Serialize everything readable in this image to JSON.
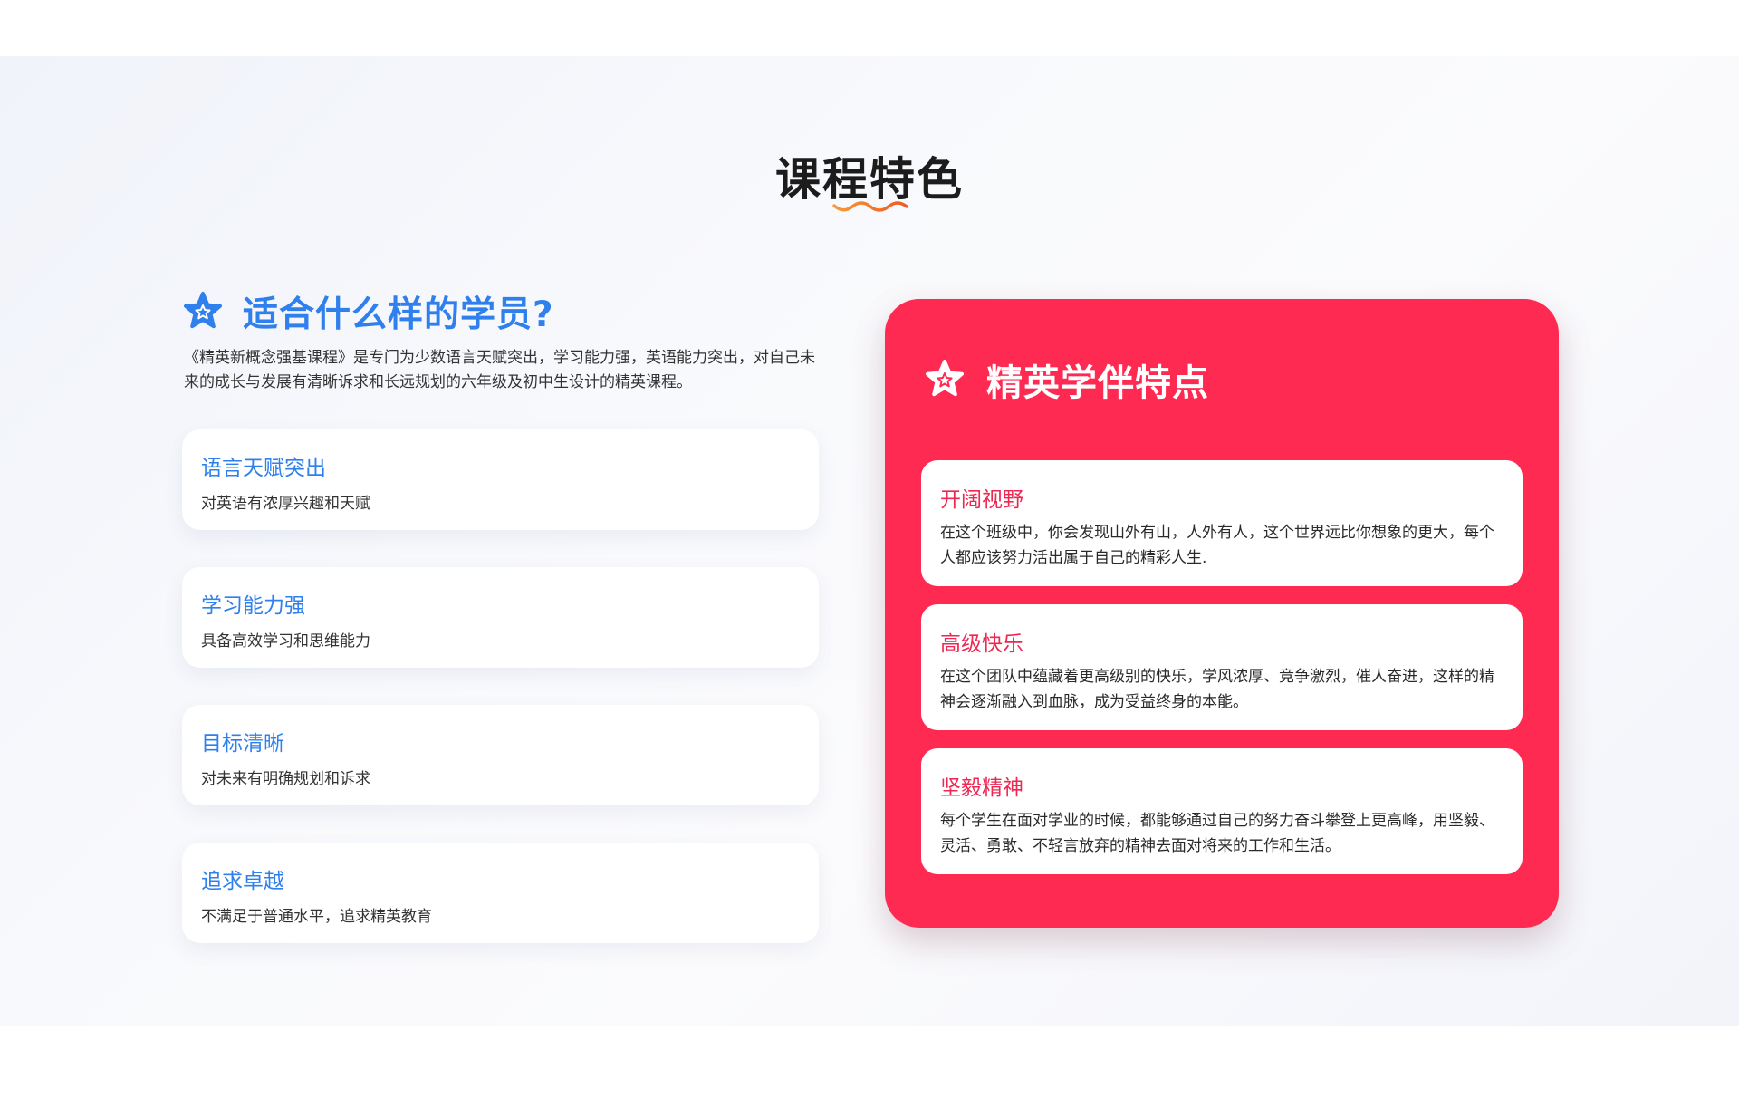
{
  "section": {
    "title": "课程特色"
  },
  "colors": {
    "accent_blue": "#2f80ed",
    "accent_red": "#ff2a52",
    "wave_orange": "#f07a2a"
  },
  "left": {
    "heading": "适合什么样的学员?",
    "heading_icon": "star-icon",
    "description": "《精英新概念强基课程》是专门为少数语言天赋突出，学习能力强，英语能力突出，对自己未来的成长与发展有清晰诉求和长远规划的六年级及初中生设计的精英课程。",
    "features": [
      {
        "title": "语言天赋突出",
        "desc": "对英语有浓厚兴趣和天赋"
      },
      {
        "title": "学习能力强",
        "desc": "具备高效学习和思维能力"
      },
      {
        "title": "目标清晰",
        "desc": "对未来有明确规划和诉求"
      },
      {
        "title": "追求卓越",
        "desc": "不满足于普通水平，追求精英教育"
      }
    ]
  },
  "right": {
    "heading": "精英学伴特点",
    "heading_icon": "star-icon",
    "traits": [
      {
        "title": "开阔视野",
        "desc": "在这个班级中，你会发现山外有山，人外有人，这个世界远比你想象的更大，每个人都应该努力活出属于自己的精彩人生."
      },
      {
        "title": "高级快乐",
        "desc": "在这个团队中蕴藏着更高级别的快乐，学风浓厚、竞争激烈，催人奋进，这样的精神会逐渐融入到血脉，成为受益终身的本能。"
      },
      {
        "title": "坚毅精神",
        "desc": "每个学生在面对学业的时候，都能够通过自己的努力奋斗攀登上更高峰，用坚毅、灵活、勇敢、不轻言放弃的精神去面对将来的工作和生活。"
      }
    ]
  }
}
